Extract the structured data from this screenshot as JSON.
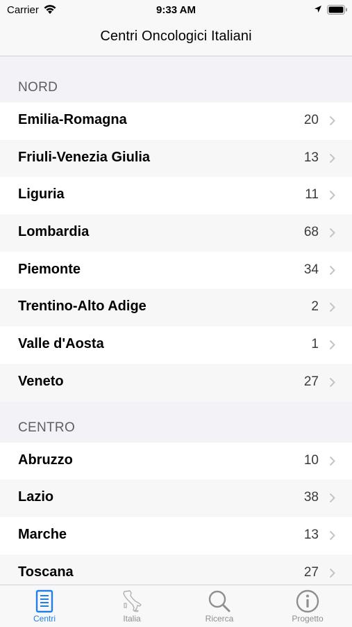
{
  "status_bar": {
    "carrier": "Carrier",
    "time": "9:33 AM"
  },
  "nav": {
    "title": "Centri Oncologici Italiani"
  },
  "sections": [
    {
      "header": "NORD",
      "rows": [
        {
          "name": "Emilia-Romagna",
          "count": "20"
        },
        {
          "name": "Friuli-Venezia Giulia",
          "count": "13"
        },
        {
          "name": "Liguria",
          "count": "11"
        },
        {
          "name": "Lombardia",
          "count": "68"
        },
        {
          "name": "Piemonte",
          "count": "34"
        },
        {
          "name": "Trentino-Alto Adige",
          "count": "2"
        },
        {
          "name": "Valle d'Aosta",
          "count": "1"
        },
        {
          "name": "Veneto",
          "count": "27"
        }
      ]
    },
    {
      "header": "CENTRO",
      "rows": [
        {
          "name": "Abruzzo",
          "count": "10"
        },
        {
          "name": "Lazio",
          "count": "38"
        },
        {
          "name": "Marche",
          "count": "13"
        },
        {
          "name": "Toscana",
          "count": "27"
        }
      ]
    }
  ],
  "tabs": [
    {
      "label": "Centri",
      "icon": "list-document-icon",
      "active": true
    },
    {
      "label": "Italia",
      "icon": "italy-map-icon",
      "active": false
    },
    {
      "label": "Ricerca",
      "icon": "magnifier-icon",
      "active": false
    },
    {
      "label": "Progetto",
      "icon": "info-icon",
      "active": false
    }
  ],
  "colors": {
    "accent": "#1e7fe6",
    "inactive": "#8e8e93"
  }
}
